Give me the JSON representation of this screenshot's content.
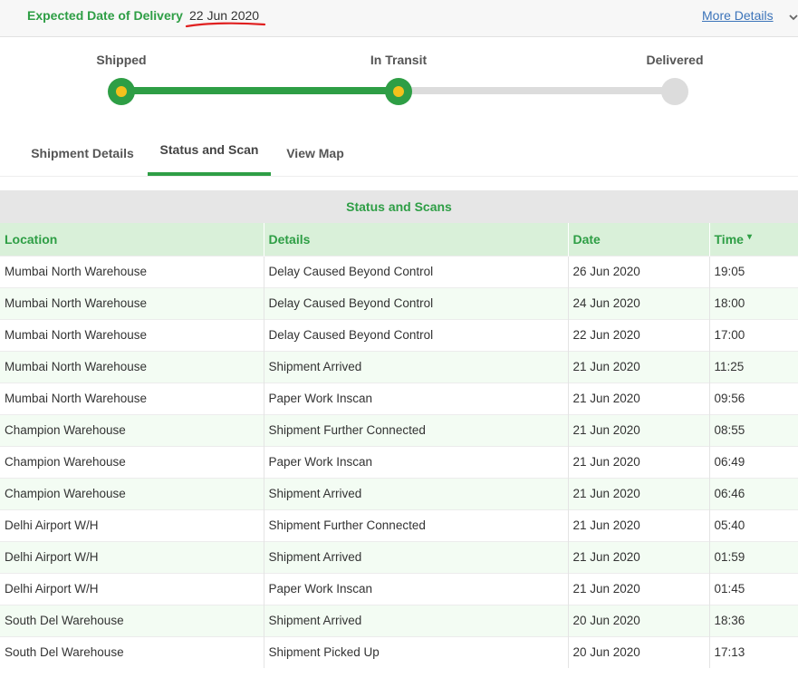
{
  "header": {
    "edd_label": "Expected Date of Delivery",
    "edd_value": "22 Jun 2020",
    "more_details": "More Details"
  },
  "tracker": {
    "steps": [
      "Shipped",
      "In Transit",
      "Delivered"
    ],
    "progress_fraction": 0.5,
    "colors": {
      "done": "#2e9e45",
      "dot": "#f4c11c",
      "pending": "#dcdcdc"
    }
  },
  "tabs": {
    "items": [
      "Shipment Details",
      "Status and Scan",
      "View Map"
    ],
    "active": "Status and Scan"
  },
  "scans": {
    "title": "Status and Scans",
    "columns": [
      "Location",
      "Details",
      "Date",
      "Time"
    ],
    "sort_indicator": "▾",
    "rows": [
      [
        "Mumbai North Warehouse",
        "Delay Caused Beyond Control",
        "26 Jun 2020",
        "19:05"
      ],
      [
        "Mumbai North Warehouse",
        "Delay Caused Beyond Control",
        "24 Jun 2020",
        "18:00"
      ],
      [
        "Mumbai North Warehouse",
        "Delay Caused Beyond Control",
        "22 Jun 2020",
        "17:00"
      ],
      [
        "Mumbai North Warehouse",
        "Shipment Arrived",
        "21 Jun 2020",
        "11:25"
      ],
      [
        "Mumbai North Warehouse",
        "Paper Work Inscan",
        "21 Jun 2020",
        "09:56"
      ],
      [
        "Champion Warehouse",
        "Shipment Further Connected",
        "21 Jun 2020",
        "08:55"
      ],
      [
        "Champion Warehouse",
        "Paper Work Inscan",
        "21 Jun 2020",
        "06:49"
      ],
      [
        "Champion Warehouse",
        "Shipment Arrived",
        "21 Jun 2020",
        "06:46"
      ],
      [
        "Delhi Airport W/H",
        "Shipment Further Connected",
        "21 Jun 2020",
        "05:40"
      ],
      [
        "Delhi Airport W/H",
        "Shipment Arrived",
        "21 Jun 2020",
        "01:59"
      ],
      [
        "Delhi Airport W/H",
        "Paper Work Inscan",
        "21 Jun 2020",
        "01:45"
      ],
      [
        "South Del Warehouse",
        "Shipment Arrived",
        "20 Jun 2020",
        "18:36"
      ],
      [
        "South Del Warehouse",
        "Shipment Picked Up",
        "20 Jun 2020",
        "17:13"
      ]
    ]
  }
}
